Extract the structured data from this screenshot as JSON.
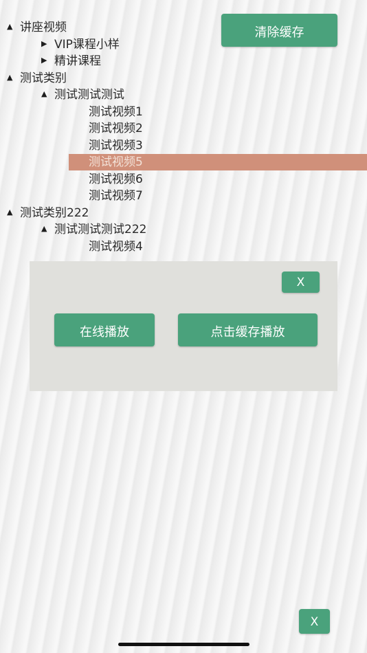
{
  "toolbar": {
    "clear_cache_label": "清除缓存"
  },
  "tree": {
    "nodes": [
      {
        "toggle": "▲",
        "label": "讲座视频"
      },
      {
        "toggle": "▶",
        "label": "VIP课程小样"
      },
      {
        "toggle": "▶",
        "label": "精讲课程"
      },
      {
        "toggle": "▲",
        "label": "测试类别"
      },
      {
        "toggle": "▲",
        "label": "测试测试测试"
      },
      {
        "label": "测试视频1"
      },
      {
        "label": "测试视频2"
      },
      {
        "label": "测试视频3"
      },
      {
        "label": "测试视频5",
        "selected": true
      },
      {
        "label": "测试视频6"
      },
      {
        "label": "测试视频7"
      },
      {
        "toggle": "▲",
        "label": "测试类别222"
      },
      {
        "toggle": "▲",
        "label": "测试测试测试222"
      },
      {
        "label": "测试视频4"
      }
    ]
  },
  "dialog": {
    "close_label": "X",
    "online_play_label": "在线播放",
    "cache_play_label": "点击缓存播放"
  },
  "corner": {
    "close_label": "X"
  },
  "colors": {
    "button": "#4aa27c",
    "selected_row": "#d0907a",
    "dialog_bg": "#e0e0dc"
  }
}
